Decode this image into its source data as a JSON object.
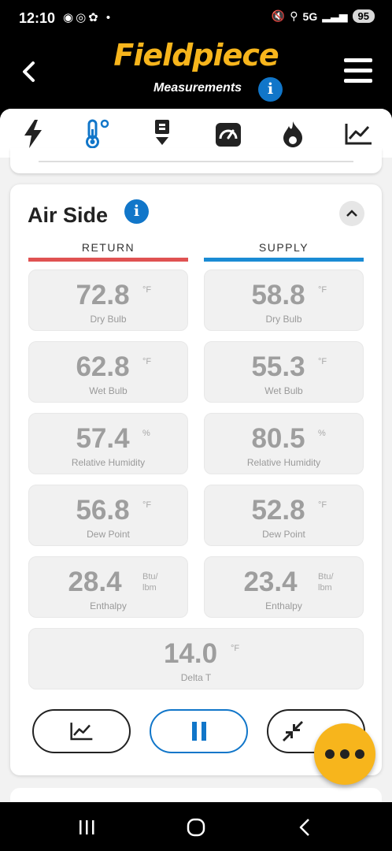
{
  "status": {
    "time": "12:10",
    "network": "5G",
    "battery": "95"
  },
  "header": {
    "logo": "Fieldpiece",
    "subtitle": "Measurements"
  },
  "tabs": [
    {
      "icon": "lightning-icon"
    },
    {
      "icon": "thermometer-icon",
      "active": true
    },
    {
      "icon": "pump-icon"
    },
    {
      "icon": "gauge-icon"
    },
    {
      "icon": "flame-icon"
    },
    {
      "icon": "trend-chart-icon"
    }
  ],
  "air_side": {
    "title": "Air Side",
    "return_label": "RETURN",
    "supply_label": "SUPPLY",
    "return_color": "#e05252",
    "supply_color": "#1a8bd4",
    "return": {
      "dry_bulb": {
        "value": "72.8",
        "unit": "°F",
        "label": "Dry Bulb"
      },
      "wet_bulb": {
        "value": "62.8",
        "unit": "°F",
        "label": "Wet Bulb"
      },
      "rh": {
        "value": "57.4",
        "unit": "%",
        "label": "Relative Humidity"
      },
      "dew_point": {
        "value": "56.8",
        "unit": "°F",
        "label": "Dew Point"
      },
      "enthalpy": {
        "value": "28.4",
        "unit1": "Btu/",
        "unit2": "lbm",
        "label": "Enthalpy"
      }
    },
    "supply": {
      "dry_bulb": {
        "value": "58.8",
        "unit": "°F",
        "label": "Dry Bulb"
      },
      "wet_bulb": {
        "value": "55.3",
        "unit": "°F",
        "label": "Wet Bulb"
      },
      "rh": {
        "value": "80.5",
        "unit": "%",
        "label": "Relative Humidity"
      },
      "dew_point": {
        "value": "52.8",
        "unit": "°F",
        "label": "Dew Point"
      },
      "enthalpy": {
        "value": "23.4",
        "unit1": "Btu/",
        "unit2": "lbm",
        "label": "Enthalpy"
      }
    },
    "delta_t": {
      "value": "14.0",
      "unit": "°F",
      "label": "Delta T"
    }
  },
  "colors": {
    "brand_yellow": "#f7b51c",
    "info_blue": "#1176c9"
  }
}
